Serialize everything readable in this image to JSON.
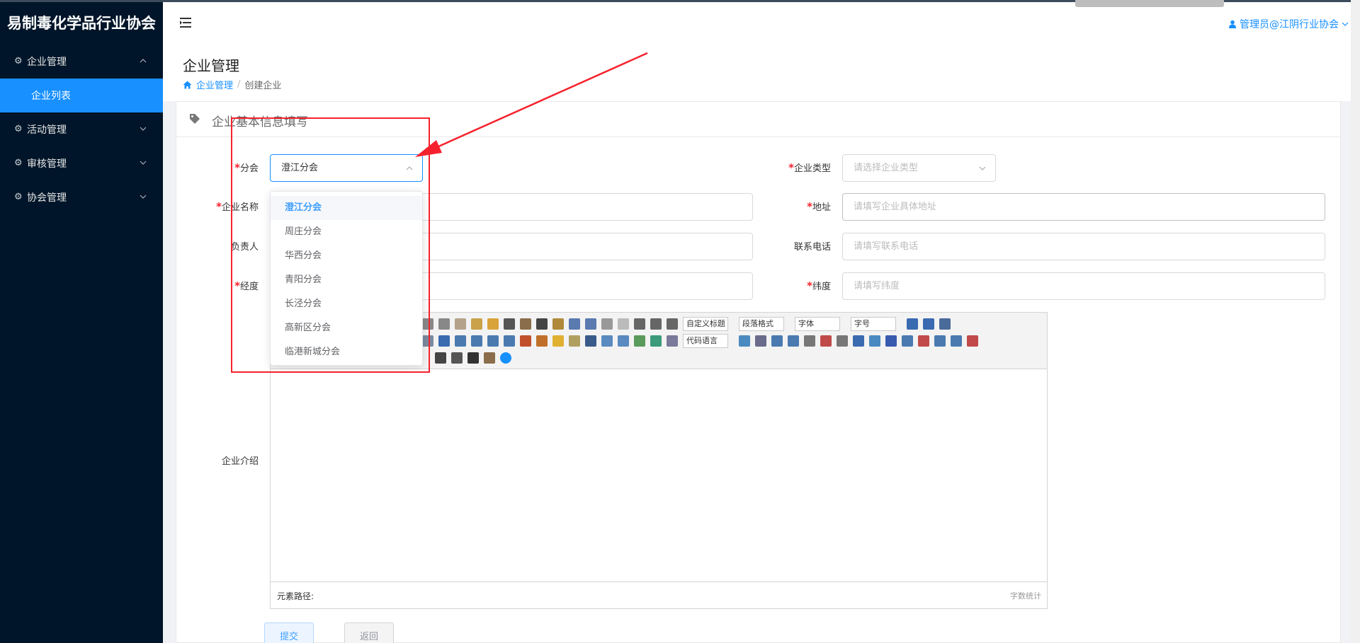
{
  "app": {
    "brand": "易制毒化学品行业协会"
  },
  "sidebar": {
    "items": [
      {
        "label": "企业管理",
        "expanded": true,
        "children": [
          {
            "label": "企业列表",
            "active": true
          }
        ]
      },
      {
        "label": "活动管理",
        "expanded": false
      },
      {
        "label": "审核管理",
        "expanded": false
      },
      {
        "label": "协会管理",
        "expanded": false
      }
    ]
  },
  "header": {
    "user": "管理员@江阴行业协会"
  },
  "page": {
    "title": "企业管理",
    "breadcrumb": {
      "home": "企业管理",
      "current": "创建企业"
    }
  },
  "form": {
    "section_title": "企业基本信息填写",
    "branch": {
      "label": "分会",
      "value": "澄江分会"
    },
    "company_type": {
      "label": "企业类型",
      "placeholder": "请选择企业类型"
    },
    "company_name": {
      "label": "企业名称"
    },
    "address": {
      "label": "地址",
      "placeholder": "请填写企业具体地址"
    },
    "manager": {
      "label": "负责人"
    },
    "phone": {
      "label": "联系电话",
      "placeholder": "请填写联系电话"
    },
    "longitude": {
      "label": "经度"
    },
    "latitude": {
      "label": "纬度",
      "placeholder": "请填写纬度"
    },
    "intro": {
      "label": "企业介绍"
    }
  },
  "dropdown": {
    "options": [
      "澄江分会",
      "周庄分会",
      "华西分会",
      "青阳分会",
      "长泾分会",
      "高新区分会",
      "临港新城分会"
    ],
    "selected": "澄江分会"
  },
  "editor": {
    "combos": {
      "custom_title": "自定义标题",
      "paragraph": "段落格式",
      "font": "字体",
      "size": "字号",
      "code_lang": "代码语言"
    },
    "element_path_label": "元素路径:",
    "word_count_label": "字数统计"
  },
  "buttons": {
    "submit": "提交",
    "back": "返回"
  },
  "colors": {
    "sidebar_bg": "#001529",
    "accent": "#1890ff",
    "required": "#f5222d",
    "annotation": "#f5222d"
  }
}
